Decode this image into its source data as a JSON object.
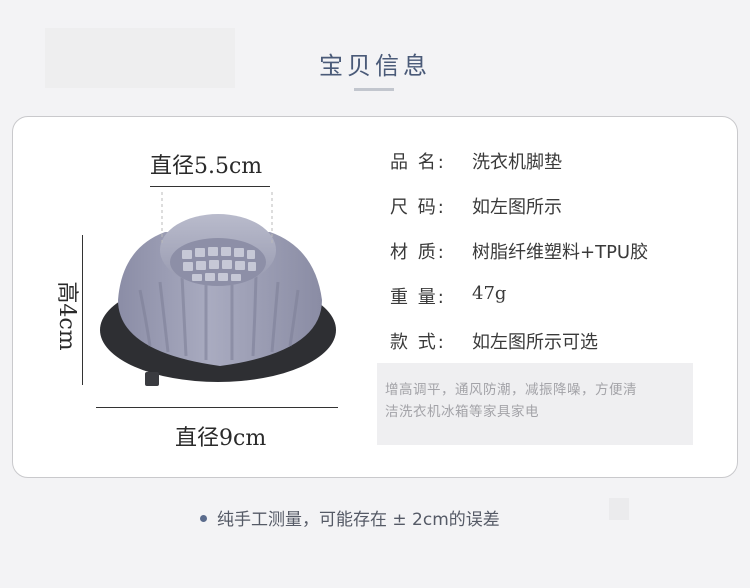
{
  "section_title": "宝贝信息",
  "dimensions": {
    "top_diameter": "直径5.5cm",
    "bottom_diameter": "直径9cm",
    "height": "高4cm"
  },
  "specs": [
    {
      "label": "品 名:",
      "value": "洗衣机脚垫"
    },
    {
      "label": "尺 码:",
      "value": "如左图所示"
    },
    {
      "label": "材 质:",
      "value": "树脂纤维塑料+TPU胶"
    },
    {
      "label": "重 量:",
      "value": "47g"
    },
    {
      "label": "款 式:",
      "value": "如左图所示可选"
    }
  ],
  "note_lines": [
    "增高调平，通风防潮，减振降噪，方便清",
    "洁洗衣机冰箱等家具家电"
  ],
  "footnote": "纯手工测量，可能存在 ± 2cm的误差",
  "colors": {
    "title": "#4a5a78",
    "pad_body": "#9a9cb2",
    "pad_base": "#2e2f33"
  }
}
